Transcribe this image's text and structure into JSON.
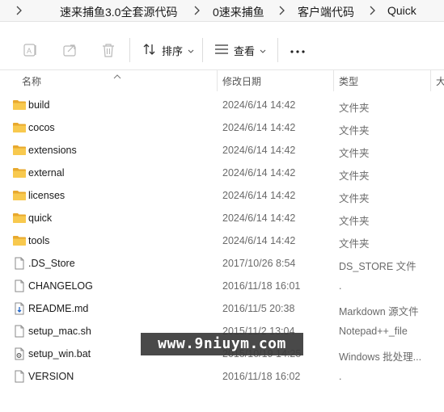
{
  "breadcrumb": {
    "items": [
      "速来捕鱼3.0全套源代码",
      "0速来捕鱼",
      "客户端代码",
      "Quick"
    ]
  },
  "toolbar": {
    "icons": [
      "rename-icon",
      "share-icon",
      "delete-icon"
    ],
    "sort_label": "排序",
    "view_label": "查看",
    "more_label": "..."
  },
  "columns": {
    "name": "名称",
    "date": "修改日期",
    "type": "类型",
    "size": "大"
  },
  "files": [
    {
      "name": "build",
      "date": "2024/6/14 14:42",
      "type": "文件夹",
      "icon": "folder-icon"
    },
    {
      "name": "cocos",
      "date": "2024/6/14 14:42",
      "type": "文件夹",
      "icon": "folder-icon"
    },
    {
      "name": "extensions",
      "date": "2024/6/14 14:42",
      "type": "文件夹",
      "icon": "folder-icon"
    },
    {
      "name": "external",
      "date": "2024/6/14 14:42",
      "type": "文件夹",
      "icon": "folder-icon"
    },
    {
      "name": "licenses",
      "date": "2024/6/14 14:42",
      "type": "文件夹",
      "icon": "folder-icon"
    },
    {
      "name": "quick",
      "date": "2024/6/14 14:42",
      "type": "文件夹",
      "icon": "folder-icon"
    },
    {
      "name": "tools",
      "date": "2024/6/14 14:42",
      "type": "文件夹",
      "icon": "folder-icon"
    },
    {
      "name": ".DS_Store",
      "date": "2017/10/26 8:54",
      "type": "DS_STORE 文件",
      "icon": "file-icon"
    },
    {
      "name": "CHANGELOG",
      "date": "2016/11/18 16:01",
      "type": ".",
      "icon": "file-icon"
    },
    {
      "name": "README.md",
      "date": "2016/11/5 20:38",
      "type": "Markdown 源文件",
      "icon": "markdown-file-icon"
    },
    {
      "name": "setup_mac.sh",
      "date": "2015/11/2 13:04",
      "type": "Notepad++_file",
      "icon": "file-icon"
    },
    {
      "name": "setup_win.bat",
      "date": "2015/10/19 14:25",
      "type": "Windows 批处理...",
      "icon": "batch-file-icon"
    },
    {
      "name": "VERSION",
      "date": "2016/11/18 16:02",
      "type": ".",
      "icon": "file-icon"
    }
  ],
  "watermark": "www.9niuym.com",
  "colors": {
    "folder": "#f8c94e",
    "folder_dark": "#e8a92e",
    "text_primary": "#1a1a1a",
    "text_secondary": "#6a6a6a",
    "breadcrumb_bg": "#f7f7f7"
  }
}
